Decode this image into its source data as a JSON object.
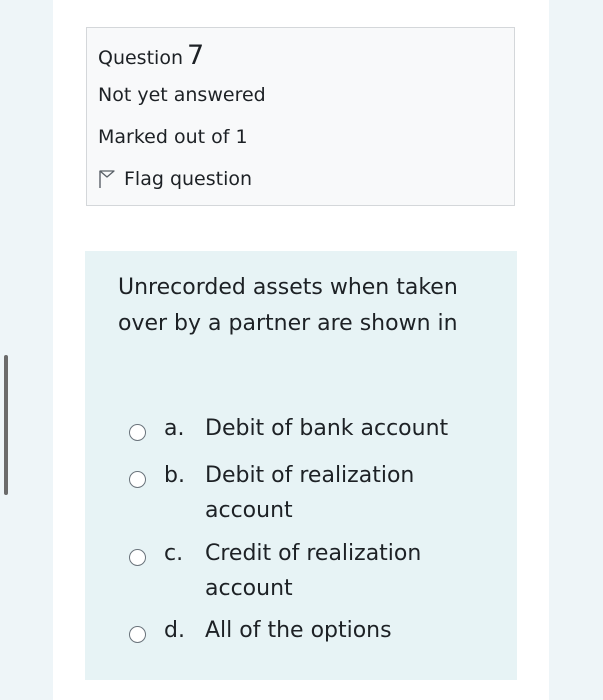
{
  "question_info": {
    "label": "Question",
    "number": "7",
    "state": "Not yet answered",
    "marks": "Marked out of 1",
    "flag_label": "Flag question"
  },
  "question": {
    "text": "Unrecorded assets when taken over by a partner are shown in",
    "options": [
      {
        "letter": "a.",
        "text": "Debit of bank account",
        "selected": false
      },
      {
        "letter": "b.",
        "text": "Debit of realization account",
        "selected": false
      },
      {
        "letter": "c.",
        "text": "Credit of realization account",
        "selected": false
      },
      {
        "letter": "d.",
        "text": "All of the options",
        "selected": false
      }
    ]
  },
  "colors": {
    "background": "#eef5f8",
    "info_box": "#f8f9fa",
    "question_box": "#e7f3f5",
    "text": "#1d2125"
  }
}
